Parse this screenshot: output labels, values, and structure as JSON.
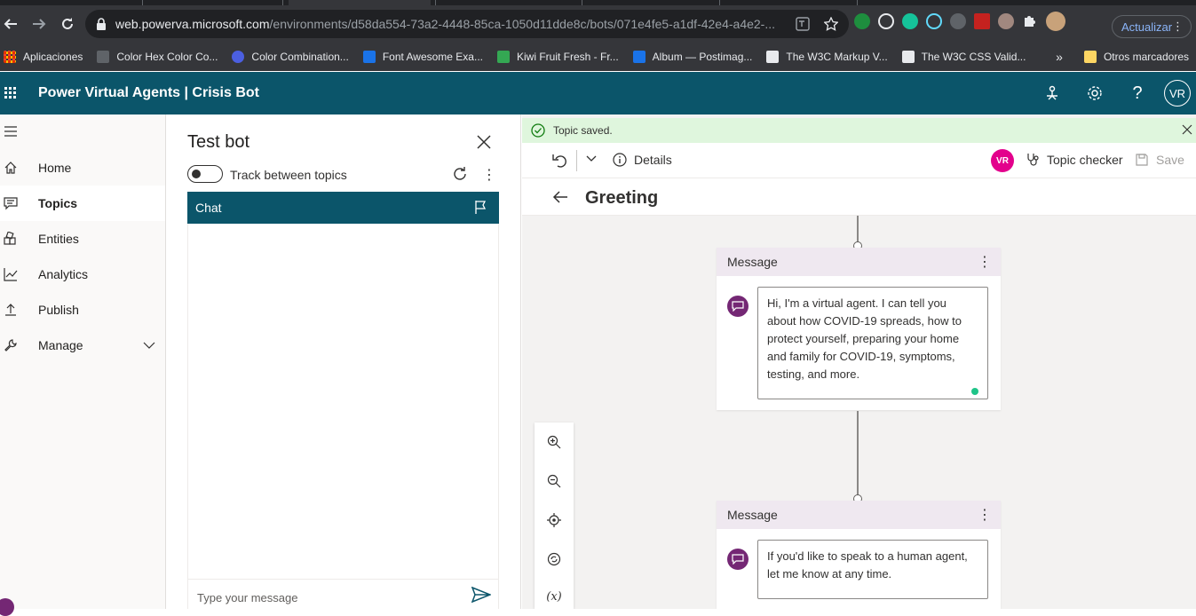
{
  "browser": {
    "url_host": "web.powerva.microsoft.com",
    "url_path": "/environments/d58da554-73a2-4448-85ca-1050d11dde8c/bots/071e4fe5-a1df-42e4-a4e2-...",
    "update_label": "Actualizar",
    "bookmarks": [
      {
        "label": "Aplicaciones",
        "color": "#ea4335"
      },
      {
        "label": "Color Hex Color Co...",
        "color": "#5f6368"
      },
      {
        "label": "Color Combination...",
        "color": "#4285f4"
      },
      {
        "label": "Font Awesome Exa...",
        "color": "#1a73e8"
      },
      {
        "label": "Kiwi Fruit Fresh - Fr...",
        "color": "#34a853"
      },
      {
        "label": "Album — Postimag...",
        "color": "#1a73e8"
      },
      {
        "label": "The W3C Markup V...",
        "color": "#e8eaed"
      },
      {
        "label": "The W3C CSS Valid...",
        "color": "#e8eaed"
      }
    ],
    "other_bookmarks": "Otros marcadores",
    "overflow": "»"
  },
  "app": {
    "title": "Power Virtual Agents | Crisis Bot",
    "avatar_initials": "VR",
    "brand_color": "#0b556a"
  },
  "nav": {
    "items": [
      {
        "label": "Home",
        "icon": "home-icon"
      },
      {
        "label": "Topics",
        "icon": "topics-icon"
      },
      {
        "label": "Entities",
        "icon": "entities-icon"
      },
      {
        "label": "Analytics",
        "icon": "analytics-icon"
      },
      {
        "label": "Publish",
        "icon": "publish-icon"
      },
      {
        "label": "Manage",
        "icon": "manage-icon"
      }
    ],
    "selected": "Topics"
  },
  "testbot": {
    "title": "Test bot",
    "toggle_label": "Track between topics",
    "chat_tab": "Chat",
    "message_placeholder": "Type your message"
  },
  "editor": {
    "notification": "Topic saved.",
    "details_label": "Details",
    "user_badge": "VR",
    "topic_checker_label": "Topic checker",
    "save_label": "Save",
    "topic_title": "Greeting",
    "nodes": [
      {
        "header": "Message",
        "text": "Hi, I'm a virtual agent. I can tell you about how COVID-19 spreads, how to protect yourself, preparing your home and family for COVID-19, symptoms, testing, and more."
      },
      {
        "header": "Message",
        "text": "If you'd like to speak to a human agent, let me know at any time."
      }
    ],
    "variable_tool_label": "(x)"
  }
}
